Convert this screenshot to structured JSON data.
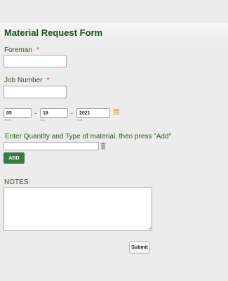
{
  "form": {
    "title": "Material Request Form"
  },
  "fields": {
    "foreman": {
      "label": "Foreman",
      "required_mark": "*",
      "value": ""
    },
    "job_number": {
      "label": "Job Number",
      "required_mark": "*",
      "value": ""
    },
    "date": {
      "month": {
        "value": "05",
        "sublabel": "Month"
      },
      "day": {
        "value": "18",
        "sublabel": "Day"
      },
      "year": {
        "value": "2021",
        "sublabel": "Year"
      },
      "separator": "-"
    },
    "material": {
      "label": "Enter Quantity and Type of material, then press \"Add\"",
      "value": ""
    },
    "notes": {
      "label": "NOTES",
      "value": ""
    }
  },
  "buttons": {
    "add_label": "ADD",
    "submit_label": "Submit"
  },
  "icons": {
    "calendar": "calendar-icon",
    "trash": "trash-icon",
    "resize": "resize-handle-icon"
  },
  "colors": {
    "title": "#1f4a1f",
    "label": "#2d5a1f",
    "required": "#d43a2a",
    "add_button_bg": "#3a7a47",
    "background": "#ececec"
  }
}
